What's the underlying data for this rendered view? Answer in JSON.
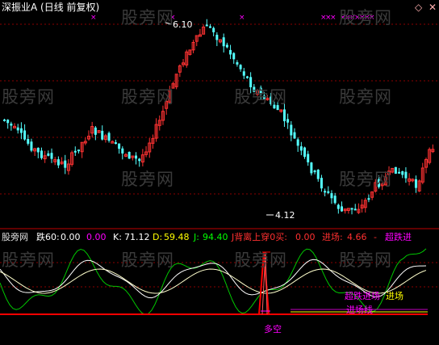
{
  "title": "深振业A (日线 前复权)",
  "top_right_icons": [
    "diamond-icon",
    "cross-icon"
  ],
  "annotations": {
    "peak_price": "6.10",
    "low_price": "4.12",
    "duo_kong": "多空",
    "chao_die_jin_chang": "超跌进场",
    "jin_chang": "进场",
    "jin_chang_xian": "进场线"
  },
  "indicator_bar": {
    "name": "股旁网",
    "die60_label": "跌60:",
    "die60_value": "0.00",
    "extra_value": "0.00",
    "k_label": "K:",
    "k_value": "71.12",
    "d_label": "D:",
    "d_value": "59.48",
    "j_label": "J:",
    "j_value": "94.40",
    "j_bei_label": "J背离上穿0买:",
    "j_bei_value": "0.00",
    "jinchang_label": "进场:",
    "jinchang_value": "4.66",
    "dash": "-",
    "chaodie_label": "超跌进"
  },
  "watermark": "股旁网",
  "colors": {
    "up": "#ff3232",
    "down": "#54ffff",
    "grid": "#8b0000",
    "k_line": "#ffffff",
    "d_line": "#ffff00",
    "j_line": "#00c800",
    "buy_marker": "#ff00ff",
    "zero_line": "#ff0000"
  }
}
